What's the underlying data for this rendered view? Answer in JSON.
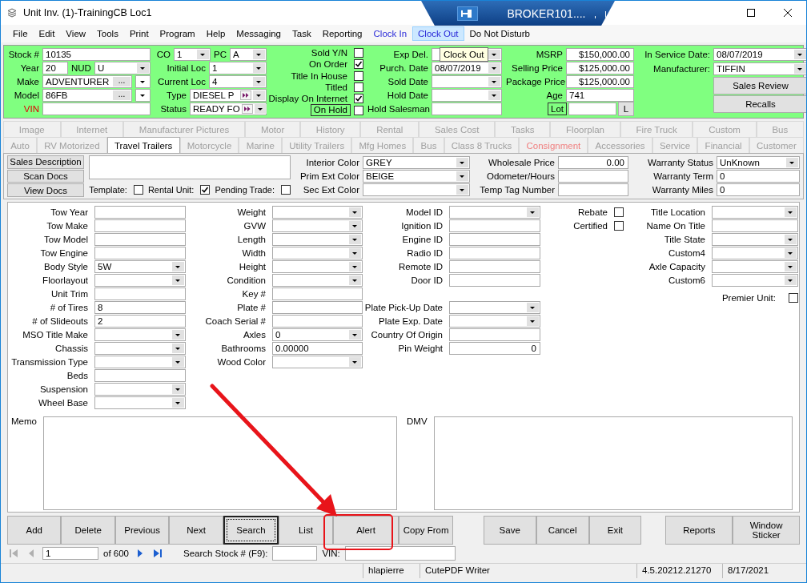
{
  "window": {
    "title": "Unit Inv. (1)-TrainingCB Loc1"
  },
  "remote_bar": {
    "title": "BROKER101...."
  },
  "menu": {
    "items": [
      {
        "label": "File",
        "kind": "menu",
        "selected": false
      },
      {
        "label": "Edit",
        "kind": "menu",
        "selected": false
      },
      {
        "label": "View",
        "kind": "menu",
        "selected": false
      },
      {
        "label": "Tools",
        "kind": "menu",
        "selected": false
      },
      {
        "label": "Print",
        "kind": "menu",
        "selected": false
      },
      {
        "label": "Program",
        "kind": "menu",
        "selected": false
      },
      {
        "label": "Help",
        "kind": "menu",
        "selected": false
      },
      {
        "label": "Messaging",
        "kind": "menu",
        "selected": false
      },
      {
        "label": "Task",
        "kind": "menu",
        "selected": false
      },
      {
        "label": "Reporting",
        "kind": "menu",
        "selected": false
      },
      {
        "label": "Clock In",
        "kind": "link",
        "selected": false
      },
      {
        "label": "Clock Out",
        "kind": "link",
        "selected": true
      },
      {
        "label": "Do Not Disturb",
        "kind": "menu",
        "selected": false
      }
    ]
  },
  "tooltip": "Clock Out",
  "header": {
    "columns": [
      {
        "rows": [
          {
            "label": "Stock #",
            "kind": "text",
            "value": "10135",
            "required": false
          },
          {
            "label": "Year",
            "kind": "text",
            "value": "20",
            "required": false,
            "inline": {
              "label": "NUD",
              "kind": "combo",
              "value": "U"
            }
          },
          {
            "label": "Make",
            "kind": "lookup",
            "value": "ADVENTURER",
            "button": "...",
            "required": false
          },
          {
            "label": "Model",
            "kind": "lookup",
            "value": "86FB",
            "button": "...",
            "required": false
          },
          {
            "label": "VIN",
            "kind": "text",
            "required": true
          }
        ]
      },
      {
        "rows": [
          {
            "label": "CO",
            "kind": "combo",
            "value": "1",
            "inline": {
              "label": "PC",
              "kind": "combo",
              "value": "A"
            }
          },
          {
            "label": "Initial Loc",
            "kind": "combo",
            "value": "1"
          },
          {
            "label": "Current Loc",
            "kind": "combo",
            "value": "4"
          },
          {
            "label": "Type",
            "kind": "jump",
            "value": "DIESEL P"
          },
          {
            "label": "Status",
            "kind": "jump",
            "value": "READY FO"
          }
        ]
      },
      {
        "rows": [
          {
            "label": "Sold Y/N",
            "kind": "check",
            "checked": false
          },
          {
            "label": "On Order",
            "kind": "check",
            "checked": true
          },
          {
            "label": "Title In House",
            "kind": "check",
            "checked": false
          },
          {
            "label": "Titled",
            "kind": "check",
            "checked": false
          },
          {
            "label": "Display On Internet",
            "kind": "check",
            "checked": true
          },
          {
            "label": "On Hold",
            "kind": "boxed_check",
            "checked": false
          }
        ]
      },
      {
        "rows": [
          {
            "label": "Exp Del.",
            "kind": "combo"
          },
          {
            "label": "Purch. Date",
            "kind": "combo",
            "value": "08/07/2019"
          },
          {
            "label": "Sold Date",
            "kind": "combo"
          },
          {
            "label": "Hold Date",
            "kind": "combo"
          },
          {
            "label": "Hold Salesman",
            "kind": "text"
          }
        ]
      },
      {
        "rows": [
          {
            "label": "MSRP",
            "kind": "amount",
            "value": "$150,000.00"
          },
          {
            "label": "Selling Price",
            "kind": "amount",
            "value": "$125,000.00"
          },
          {
            "label": "Package Price",
            "kind": "amount",
            "value": "$125,000.00"
          },
          {
            "label": "Age",
            "kind": "text",
            "value": "741"
          },
          {
            "label": "Lot",
            "kind": "lot",
            "button": "L"
          }
        ]
      },
      {
        "rows": [
          {
            "label": "In Service Date:",
            "kind": "combo",
            "value": "08/07/2019"
          },
          {
            "label": "Manufacturer:",
            "kind": "combo",
            "value": "TIFFIN"
          },
          {
            "label": "Sales Review",
            "kind": "button"
          },
          {
            "label": "Recalls",
            "kind": "button"
          }
        ]
      }
    ]
  },
  "tabs": {
    "rows": [
      {
        "items": [
          {
            "label": "Image",
            "selected": false,
            "highlight": false
          },
          {
            "label": "Internet",
            "selected": false,
            "highlight": false
          },
          {
            "label": "Manufacturer Pictures",
            "selected": false,
            "highlight": false
          },
          {
            "label": "Motor",
            "selected": false,
            "highlight": false
          },
          {
            "label": "History",
            "selected": false,
            "highlight": false
          },
          {
            "label": "Rental",
            "selected": false,
            "highlight": false
          },
          {
            "label": "Sales Cost",
            "selected": false,
            "highlight": false
          },
          {
            "label": "Tasks",
            "selected": false,
            "highlight": false
          },
          {
            "label": "Floorplan",
            "selected": false,
            "highlight": false
          },
          {
            "label": "Fire Truck",
            "selected": false,
            "highlight": false
          },
          {
            "label": "Custom",
            "selected": false,
            "highlight": false
          },
          {
            "label": "Bus",
            "selected": false,
            "highlight": false
          }
        ]
      },
      {
        "items": [
          {
            "label": "Auto",
            "selected": false,
            "highlight": false
          },
          {
            "label": "RV Motorized",
            "selected": false,
            "highlight": false
          },
          {
            "label": "Travel Trailers",
            "selected": true,
            "highlight": false
          },
          {
            "label": "Motorcycle",
            "selected": false,
            "highlight": false
          },
          {
            "label": "Marine",
            "selected": false,
            "highlight": false
          },
          {
            "label": "Utility Trailers",
            "selected": false,
            "highlight": false
          },
          {
            "label": "Mfg Homes",
            "selected": false,
            "highlight": false
          },
          {
            "label": "Bus",
            "selected": false,
            "highlight": false
          },
          {
            "label": "Class 8 Trucks",
            "selected": false,
            "highlight": false
          },
          {
            "label": "Consignment",
            "selected": false,
            "highlight": true
          },
          {
            "label": "Accessories",
            "selected": false,
            "highlight": false
          },
          {
            "label": "Service",
            "selected": false,
            "highlight": false
          },
          {
            "label": "Financial",
            "selected": false,
            "highlight": false
          },
          {
            "label": "Customer",
            "selected": false,
            "highlight": false
          }
        ]
      }
    ]
  },
  "sales": {
    "buttons": [
      "Sales Description",
      "Scan Docs",
      "View Docs"
    ],
    "flags": [
      {
        "label": "Template:",
        "checked": false
      },
      {
        "label": "Rental Unit:",
        "checked": true
      },
      {
        "label": "Pending Trade:",
        "checked": false
      }
    ],
    "columns": [
      {
        "rows": [
          {
            "label": "Interior Color",
            "kind": "combo",
            "value": "GREY"
          },
          {
            "label": "Prim Ext Color",
            "kind": "combo",
            "value": "BEIGE"
          },
          {
            "label": "Sec Ext Color",
            "kind": "combo"
          }
        ]
      },
      {
        "rows": [
          {
            "label": "Wholesale Price",
            "kind": "amount",
            "value": "0.00"
          },
          {
            "label": "Odometer/Hours",
            "kind": "text"
          },
          {
            "label": "Temp Tag Number",
            "kind": "text"
          }
        ]
      },
      {
        "rows": [
          {
            "label": "Warranty Status",
            "kind": "combo",
            "value": "UnKnown"
          },
          {
            "label": "Warranty Term",
            "kind": "text",
            "value": "0"
          },
          {
            "label": "Warranty Miles",
            "kind": "text",
            "value": "0"
          }
        ]
      }
    ]
  },
  "detail": {
    "columns": [
      {
        "groups": [
          [
            {
              "label": "Tow Year",
              "kind": "text"
            },
            {
              "label": "Tow Make",
              "kind": "text"
            },
            {
              "label": "Tow Model",
              "kind": "text"
            },
            {
              "label": "Tow Engine",
              "kind": "text"
            },
            {
              "label": "Body Style",
              "kind": "combo",
              "value": "5W"
            },
            {
              "label": "Floorlayout",
              "kind": "combo"
            },
            {
              "label": "Unit Trim",
              "kind": "text"
            },
            {
              "label": "# of Tires",
              "kind": "text",
              "value": "8"
            },
            {
              "label": "# of Slideouts",
              "kind": "text",
              "value": "2"
            },
            {
              "label": "MSO Title Make",
              "kind": "combo"
            },
            {
              "label": "Chassis",
              "kind": "combo"
            },
            {
              "label": "Transmission Type",
              "kind": "combo"
            },
            {
              "label": "Beds",
              "kind": "text"
            },
            {
              "label": "Suspension",
              "kind": "combo"
            },
            {
              "label": "Wheel Base",
              "kind": "combo"
            }
          ]
        ]
      },
      {
        "groups": [
          [
            {
              "label": "Weight",
              "kind": "combo"
            },
            {
              "label": "GVW",
              "kind": "combo"
            },
            {
              "label": "Length",
              "kind": "combo"
            },
            {
              "label": "Width",
              "kind": "combo"
            },
            {
              "label": "Height",
              "kind": "combo"
            },
            {
              "label": "Condition",
              "kind": "combo"
            },
            {
              "label": "Key #",
              "kind": "text"
            },
            {
              "label": "Plate #",
              "kind": "text"
            },
            {
              "label": "Coach Serial #",
              "kind": "text"
            },
            {
              "label": "Axles",
              "kind": "combo",
              "value": "0"
            },
            {
              "label": "Bathrooms",
              "kind": "text",
              "value": "0.00000"
            },
            {
              "label": "Wood Color",
              "kind": "combo"
            }
          ]
        ]
      },
      {
        "groups": [
          [
            {
              "label": "Model ID",
              "kind": "combo"
            },
            {
              "label": "Ignition ID",
              "kind": "text"
            },
            {
              "label": "Engine ID",
              "kind": "text"
            },
            {
              "label": "Radio ID",
              "kind": "text"
            },
            {
              "label": "Remote ID",
              "kind": "text"
            },
            {
              "label": "Door ID",
              "kind": "text"
            }
          ],
          [
            {
              "label": "Plate Pick-Up Date",
              "kind": "combo"
            },
            {
              "label": "Plate Exp. Date",
              "kind": "combo"
            },
            {
              "label": "Country Of Origin",
              "kind": "text"
            },
            {
              "label": "Pin Weight",
              "kind": "amount",
              "value": "0"
            }
          ]
        ]
      },
      {
        "groups": [
          [
            {
              "label": "Rebate",
              "kind": "check",
              "checked": false
            },
            {
              "label": "Certified",
              "kind": "check",
              "checked": false
            }
          ]
        ]
      },
      {
        "groups": [
          [
            {
              "label": "Title Location",
              "kind": "combo"
            },
            {
              "label": "Name On Title",
              "kind": "text"
            },
            {
              "label": "Title State",
              "kind": "combo"
            },
            {
              "label": "Custom4",
              "kind": "combo"
            },
            {
              "label": "Axle Capacity",
              "kind": "combo"
            },
            {
              "label": "Custom6",
              "kind": "combo"
            }
          ],
          [
            {
              "label": "Premier Unit:",
              "kind": "check",
              "checked": false
            }
          ]
        ]
      }
    ]
  },
  "notes": [
    {
      "label": "Memo"
    },
    {
      "label": "DMV"
    }
  ],
  "actions": {
    "groups": [
      [
        {
          "label": "Add",
          "focused": false
        },
        {
          "label": "Delete",
          "focused": false
        },
        {
          "label": "Previous",
          "focused": false
        },
        {
          "label": "Next",
          "focused": false
        },
        {
          "label": "Search",
          "focused": true
        },
        {
          "label": "List",
          "focused": false
        },
        {
          "label": "Alert",
          "focused": false
        },
        {
          "label": "Copy From",
          "focused": false
        }
      ],
      [
        {
          "label": "Save",
          "focused": false
        },
        {
          "label": "Cancel",
          "focused": false
        },
        {
          "label": "Exit",
          "focused": false
        }
      ],
      [
        {
          "label": "Reports",
          "focused": false
        },
        {
          "label": "Window Sticker",
          "focused": false
        }
      ]
    ]
  },
  "navigator": {
    "buttons": [
      {
        "kind": "first",
        "disabled": true
      },
      {
        "kind": "previous",
        "disabled": true
      },
      {
        "kind": "next",
        "disabled": false
      },
      {
        "kind": "last",
        "disabled": false
      }
    ],
    "page": "1",
    "of": "of 600",
    "search_label": "Search Stock # (F9):",
    "vin_label": "VIN:"
  },
  "status_bar": [
    "hlapierre",
    "CutePDF Writer",
    "4.5.20212.21270",
    "8/17/2021"
  ]
}
